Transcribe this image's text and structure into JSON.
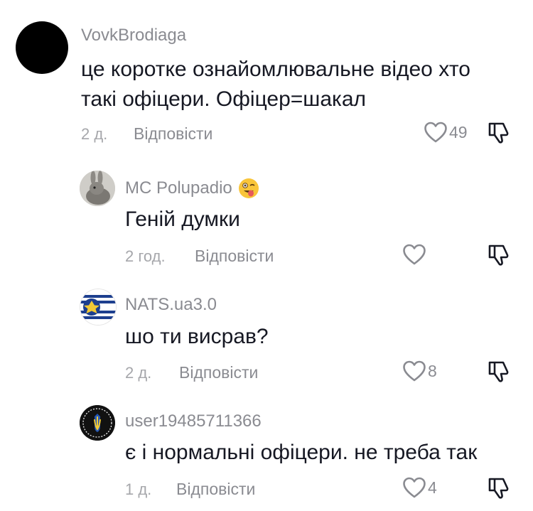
{
  "comments": [
    {
      "username": "VovkBrodiaga",
      "text_lines": [
        "це коротке ознайомлювальне відео хто",
        "такі офіцери. Офіцер=шакал"
      ],
      "time": "2 д.",
      "reply_label": "Відповісти",
      "likes": "49",
      "avatar_icon": "black-circle-avatar"
    },
    {
      "username": "MC Polupadio",
      "username_emoji": "winking-face-tongue-emoji",
      "text_lines": [
        "Геній думки"
      ],
      "time": "2 год.",
      "reply_label": "Відповісти",
      "likes": "",
      "avatar_icon": "rabbit-photo-avatar"
    },
    {
      "username": "NATS.ua3.0",
      "text_lines": [
        "шо ти висрав?"
      ],
      "time": "2 д.",
      "reply_label": "Відповісти",
      "likes": "8",
      "avatar_icon": "star-flag-avatar"
    },
    {
      "username": "user19485711366",
      "text_lines": [
        "є і нормальні офіцери. не треба так"
      ],
      "time": "1 д.",
      "reply_label": "Відповісти",
      "likes": "4",
      "avatar_icon": "trident-emblem-avatar"
    }
  ],
  "colors": {
    "text": "#161823",
    "secondary": "#8a8b91",
    "muted": "#a6a7ab"
  }
}
